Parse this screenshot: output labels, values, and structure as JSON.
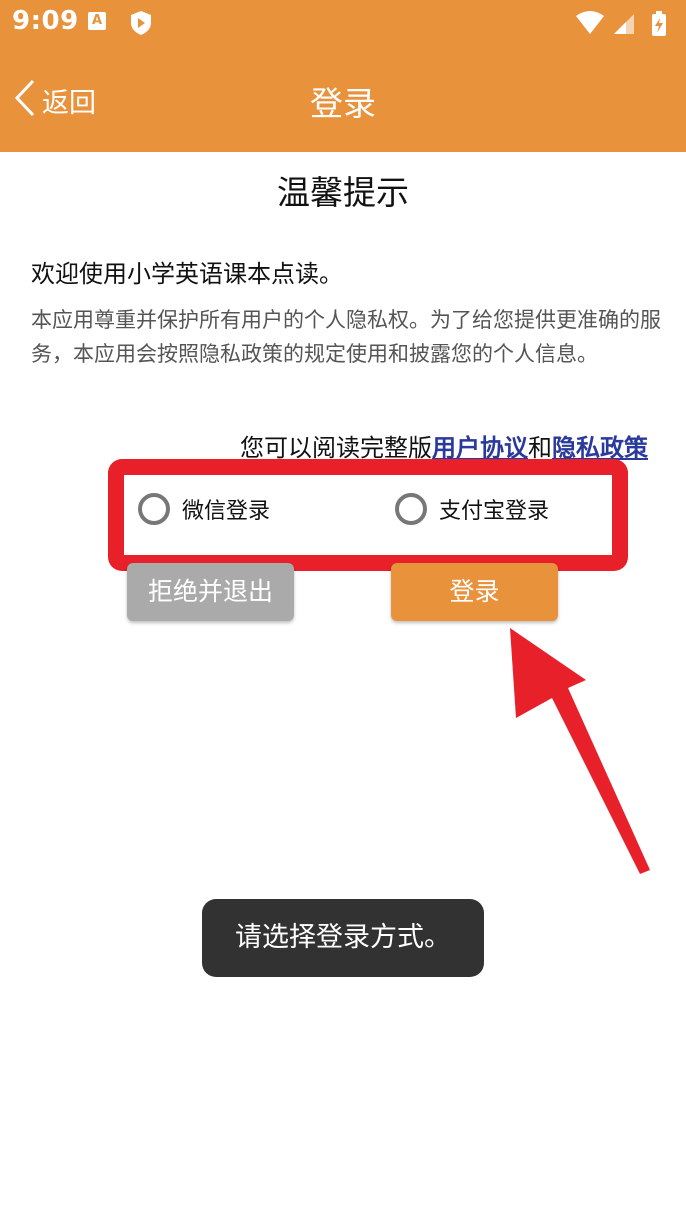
{
  "status_bar": {
    "time": "9:09",
    "icon_a_letter": "A"
  },
  "app_bar": {
    "back_label": "返回",
    "title": "登录"
  },
  "dialog": {
    "title": "温馨提示",
    "welcome": "欢迎使用小学英语课本点读。",
    "privacy_text": "本应用尊重并保护所有用户的个人隐私权。为了给您提供更准确的服务，本应用会按照隐私政策的规定使用和披露您的个人信息。",
    "read_prefix": "您可以阅读完整版",
    "user_agreement_link": "用户协议",
    "and_word": "和",
    "privacy_policy_link": "隐私政策"
  },
  "login_options": [
    {
      "label": "微信登录",
      "selected": false
    },
    {
      "label": "支付宝登录",
      "selected": false
    }
  ],
  "buttons": {
    "reject_label": "拒绝并退出",
    "login_label": "登录"
  },
  "toast": {
    "message": "请选择登录方式。"
  },
  "colors": {
    "accent": "#e9923c",
    "highlight_red": "#e8202a",
    "link_blue": "#2a3a9c",
    "reject_gray": "#aaaaaa"
  }
}
